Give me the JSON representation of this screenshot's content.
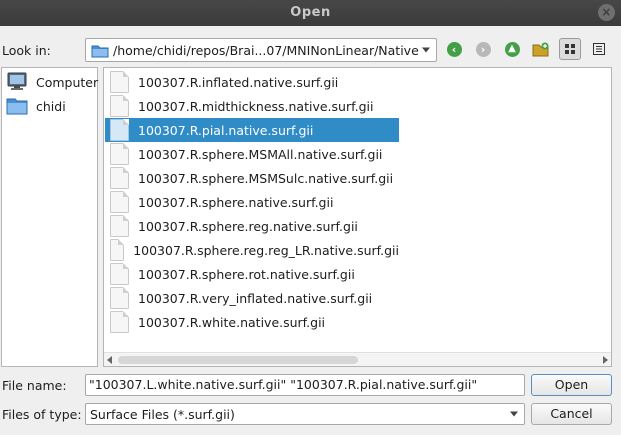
{
  "window": {
    "title": "Open"
  },
  "toolbar": {
    "look_in_label": "Look in:",
    "path": "/home/chidi/repos/Brai...07/MNINonLinear/Native"
  },
  "sidebar": {
    "items": [
      {
        "label": "Computer",
        "icon": "computer-icon"
      },
      {
        "label": "chidi",
        "icon": "folder-icon"
      }
    ]
  },
  "files": [
    {
      "name": "100307.R.inflated.native.surf.gii",
      "selected": false
    },
    {
      "name": "100307.R.midthickness.native.surf.gii",
      "selected": false
    },
    {
      "name": "100307.R.pial.native.surf.gii",
      "selected": true
    },
    {
      "name": "100307.R.sphere.MSMAll.native.surf.gii",
      "selected": false
    },
    {
      "name": "100307.R.sphere.MSMSulc.native.surf.gii",
      "selected": false
    },
    {
      "name": "100307.R.sphere.native.surf.gii",
      "selected": false
    },
    {
      "name": "100307.R.sphere.reg.native.surf.gii",
      "selected": false
    },
    {
      "name": "100307.R.sphere.reg.reg_LR.native.surf.gii",
      "selected": false
    },
    {
      "name": "100307.R.sphere.rot.native.surf.gii",
      "selected": false
    },
    {
      "name": "100307.R.very_inflated.native.surf.gii",
      "selected": false
    },
    {
      "name": "100307.R.white.native.surf.gii",
      "selected": false
    }
  ],
  "footer": {
    "file_name_label": "File name:",
    "file_name_value": "\"100307.L.white.native.surf.gii\" \"100307.R.pial.native.surf.gii\"",
    "file_type_label": "Files of type:",
    "file_type_value": "Surface Files (*.surf.gii)",
    "open_label": "Open",
    "cancel_label": "Cancel"
  },
  "colors": {
    "selection": "#308cc6",
    "titlebar": "#3f3f3f",
    "nav_green": "#4caf50"
  }
}
